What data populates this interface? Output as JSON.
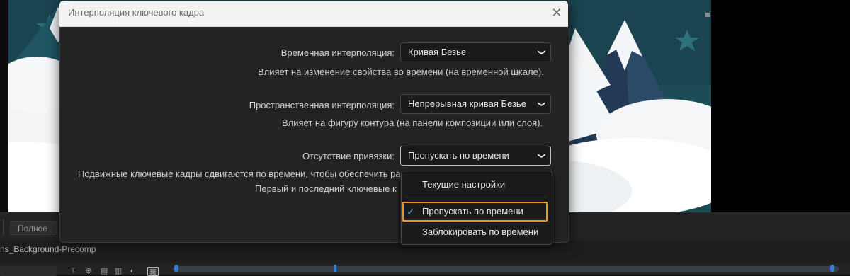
{
  "dialog": {
    "title": "Интерполяция ключевого кадра",
    "close_glyph": "✕",
    "temporal": {
      "label": "Временная интерполяция:",
      "value": "Кривая Безье",
      "description": "Влияет на изменение свойства во времени (на временной шкале)."
    },
    "spatial": {
      "label": "Пространственная интерполяция:",
      "value": "Непрерывная кривая Безье",
      "description": "Влияет на фигуру контура (на панели композиции или слоя)."
    },
    "roving": {
      "label": "Отсутствие привязки:",
      "value": "Пропускать по времени",
      "description_line1": "Подвижные ключевые кадры сдвигаются по времени, чтобы обеспечить ра",
      "description_line2": "Первый и последний ключевые к"
    }
  },
  "dropdown": {
    "items": [
      {
        "label": "Текущие настройки",
        "checked": false
      },
      {
        "label": "Пропускать по времени",
        "checked": true
      },
      {
        "label": "Заблокировать по времени",
        "checked": false
      }
    ],
    "check_glyph": "✓",
    "highlight_color": "#e8962c"
  },
  "viewer": {
    "quality_label": "Полное"
  },
  "timeline": {
    "tab_label": "ns_Background-Precomp"
  },
  "icons": {
    "chevron": "chevron-down-icon",
    "close": "close-icon",
    "check": "checkmark-icon"
  },
  "colors": {
    "scene_sky": "#1c4a55",
    "accent_blue": "#2f7fd8",
    "dialog_bg": "#232323"
  }
}
